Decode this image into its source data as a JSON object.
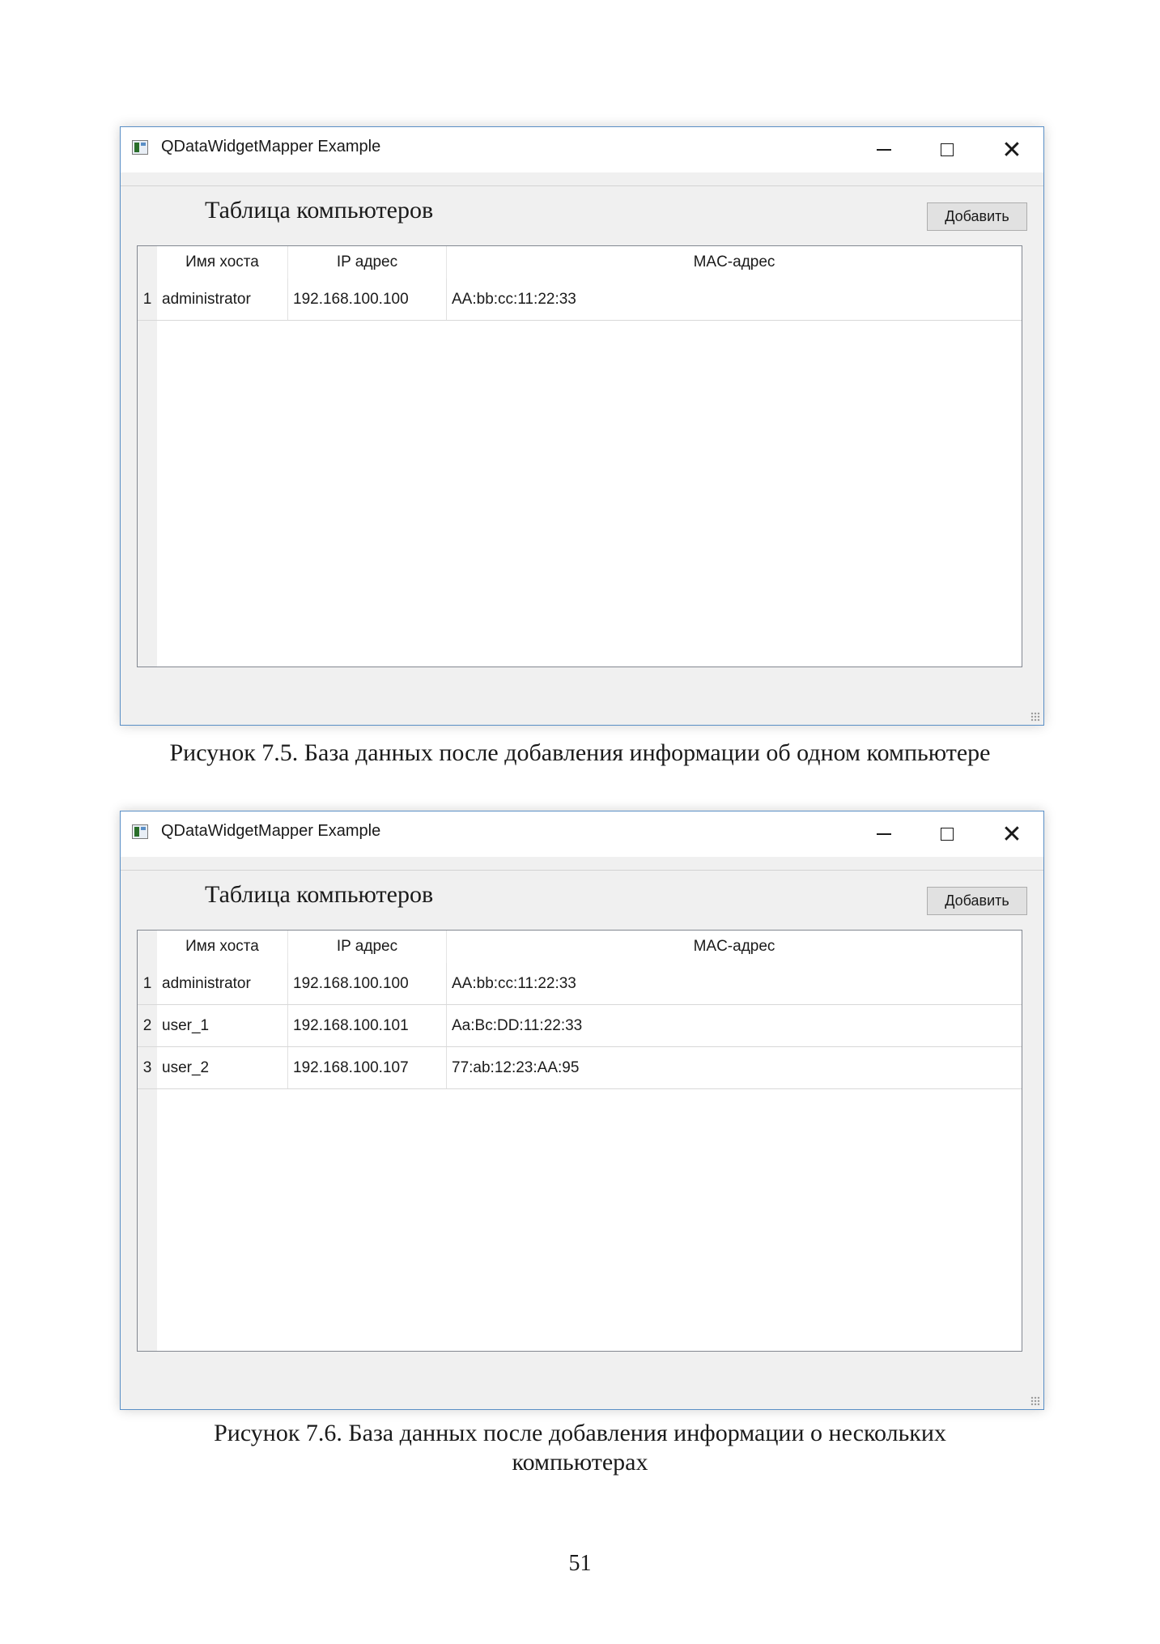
{
  "windows": [
    {
      "title": "QDataWidgetMapper Example",
      "heading": "Таблица компьютеров",
      "add_button": "Добавить",
      "columns": [
        "Имя хоста",
        "IP адрес",
        "MAC-адрес"
      ],
      "rows": [
        {
          "num": "1",
          "host": "administrator",
          "ip": "192.168.100.100",
          "mac": "AA:bb:cc:11:22:33"
        }
      ]
    },
    {
      "title": "QDataWidgetMapper Example",
      "heading": "Таблица компьютеров",
      "add_button": "Добавить",
      "columns": [
        "Имя хоста",
        "IP адрес",
        "MAC-адрес"
      ],
      "rows": [
        {
          "num": "1",
          "host": "administrator",
          "ip": "192.168.100.100",
          "mac": "AA:bb:cc:11:22:33"
        },
        {
          "num": "2",
          "host": "user_1",
          "ip": "192.168.100.101",
          "mac": "Aa:Bc:DD:11:22:33"
        },
        {
          "num": "3",
          "host": "user_2",
          "ip": "192.168.100.107",
          "mac": "77:ab:12:23:AA:95"
        }
      ]
    }
  ],
  "captions": {
    "figure_1": "Рисунок 7.5. База данных после добавления информации об одном компьютере",
    "figure_2_line1": "Рисунок 7.6. База данных после добавления информации о нескольких",
    "figure_2_line2": "компьютерах"
  },
  "page_number": "51"
}
